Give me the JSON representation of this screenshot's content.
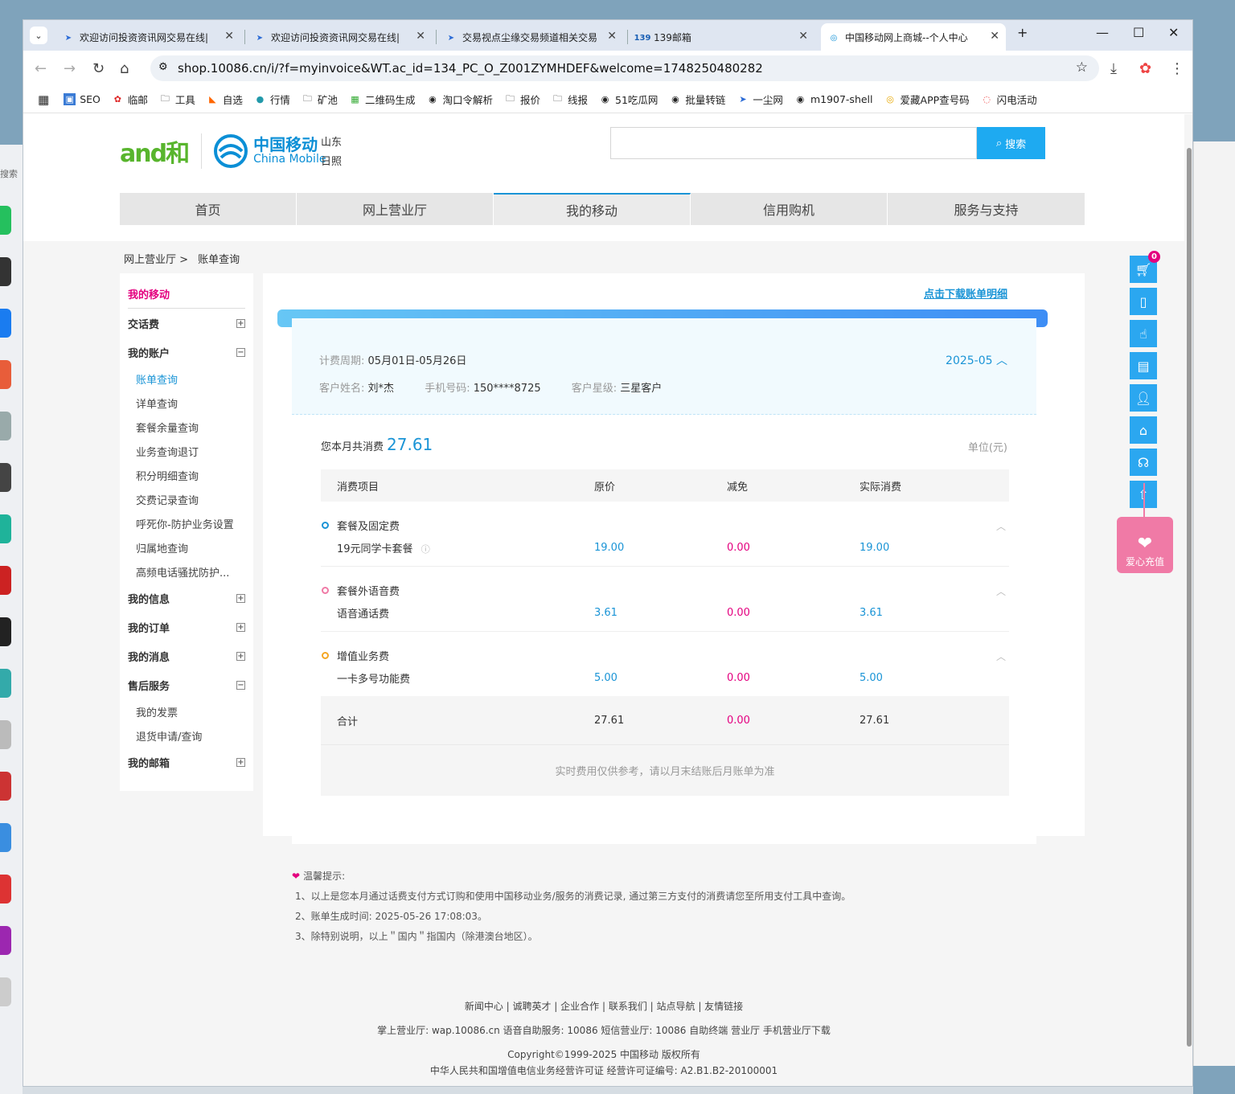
{
  "browser": {
    "tabs": [
      {
        "title": "欢迎访问投资资讯网交易在线|"
      },
      {
        "title": "欢迎访问投资资讯网交易在线|"
      },
      {
        "title": "交易视点尘缘交易频道相关交易"
      },
      {
        "title": "139邮箱"
      },
      {
        "title": "中国移动网上商城--个人中心"
      }
    ],
    "url": "shop.10086.cn/i/?f=myinvoice&WT.ac_id=134_PC_O_Z001ZYMHDEF&welcome=1748250480282",
    "bookmarks": [
      "SEO",
      "临邮",
      "工具",
      "自选",
      "行情",
      "矿池",
      "二维码生成",
      "淘口令解析",
      "报价",
      "线报",
      "51吃瓜网",
      "批量转链",
      "一尘网",
      "m1907-shell",
      "爱藏APP查号码",
      "闪电活动"
    ]
  },
  "header": {
    "logo_and": "and和",
    "logo_cn": "中国移动",
    "logo_en": "China Mobile",
    "province": "山东",
    "city": "日照",
    "search_button": "搜索"
  },
  "nav": [
    "首页",
    "网上营业厅",
    "我的移动",
    "信用购机",
    "服务与支持"
  ],
  "breadcrumb": {
    "parent": "网上营业厅 >",
    "current": "账单查询"
  },
  "sidebar": {
    "title": "我的移动",
    "sections": [
      {
        "label": "交话费",
        "toggle": "+"
      },
      {
        "label": "我的账户",
        "toggle": "−",
        "items": [
          "账单查询",
          "详单查询",
          "套餐余量查询",
          "业务查询退订",
          "积分明细查询",
          "交费记录查询",
          "呼死你-防护业务设置",
          "归属地查询",
          "高频电话骚扰防护..."
        ]
      },
      {
        "label": "我的信息",
        "toggle": "+"
      },
      {
        "label": "我的订单",
        "toggle": "+"
      },
      {
        "label": "我的消息",
        "toggle": "+"
      },
      {
        "label": "售后服务",
        "toggle": "−",
        "items": [
          "我的发票",
          "退货申请/查询"
        ]
      },
      {
        "label": "我的邮箱",
        "toggle": "+"
      }
    ]
  },
  "bill": {
    "download_link": "点击下载账单明细",
    "period_label": "计费周期:",
    "period_value": "05月01日-05月26日",
    "month": "2025-05",
    "name_label": "客户姓名:",
    "name_value": "刘*杰",
    "phone_label": "手机号码:",
    "phone_value": "150****8725",
    "level_label": "客户星级:",
    "level_value": "三星客户",
    "total_label": "您本月共消费",
    "total_value": "27.61",
    "unit": "单位(元)",
    "columns": [
      "消费项目",
      "原价",
      "减免",
      "实际消费"
    ],
    "groups": [
      {
        "name": "套餐及固定费",
        "color": "#1a94d6",
        "item": "19元同学卡套餐",
        "price": "19.00",
        "discount": "0.00",
        "actual": "19.00"
      },
      {
        "name": "套餐外语音费",
        "color": "#f07aa6",
        "item": "语音通话费",
        "price": "3.61",
        "discount": "0.00",
        "actual": "3.61"
      },
      {
        "name": "增值业务费",
        "color": "#f5a623",
        "item": "一卡多号功能费",
        "price": "5.00",
        "discount": "0.00",
        "actual": "5.00"
      }
    ],
    "sum_label": "合计",
    "sum_price": "27.61",
    "sum_discount": "0.00",
    "sum_actual": "27.61",
    "note": "实时费用仅供参考，请以月末结账后月账单为准"
  },
  "tips": {
    "title": "温馨提示:",
    "lines": [
      "1、以上是您本月通过话费支付方式订购和使用中国移动业务/服务的消费记录, 通过第三方支付的消费请您至所用支付工具中查询。",
      "2、账单生成时间: 2025-05-26 17:08:03。",
      "3、除特别说明，以上＂国内＂指国内（除港澳台地区）。"
    ]
  },
  "footer": {
    "links": "新闻中心 | 诚聘英才 | 企业合作 | 联系我们 | 站点导航 | 友情链接",
    "line2": "掌上营业厅: wap.10086.cn 语音自助服务: 10086 短信营业厅: 10086 自助终端 营业厅 手机营业厅下载",
    "copyright": "Copyright©1999-2025  中国移动  版权所有",
    "license": "中华人民共和国增值电信业务经营许可证  经营许可证编号: A2.B1.B2-20100001"
  },
  "float": {
    "cart_count": "0",
    "charity": "爱心充值"
  }
}
